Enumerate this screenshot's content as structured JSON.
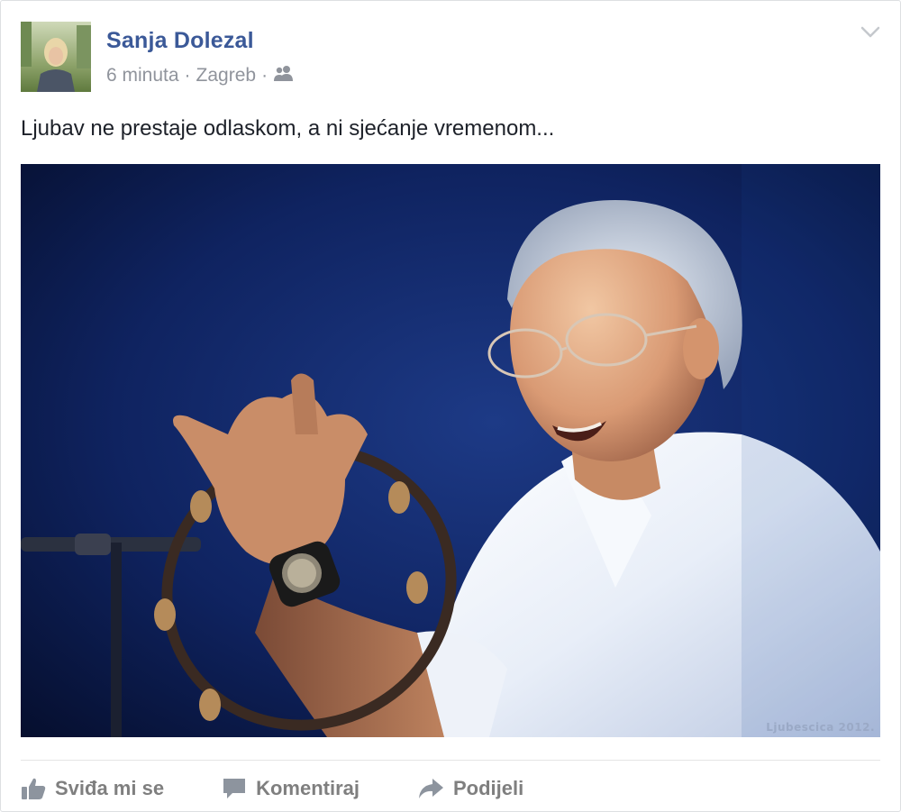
{
  "post": {
    "author": "Sanja Dolezal",
    "time": "6 minuta",
    "location": "Zagreb",
    "separator": "·",
    "audience_icon": "friends-icon",
    "text": "Ljubav ne prestaje odlaskom, a ni sjećanje vremenom...",
    "photo": {
      "watermark": "Ljubescica 2012."
    }
  },
  "actions": {
    "like_label": "Sviđa mi se",
    "comment_label": "Komentiraj",
    "share_label": "Podijeli"
  },
  "colors": {
    "author_link": "#3b5998",
    "meta_text": "#90949c",
    "action_text": "#7f7f7f"
  }
}
